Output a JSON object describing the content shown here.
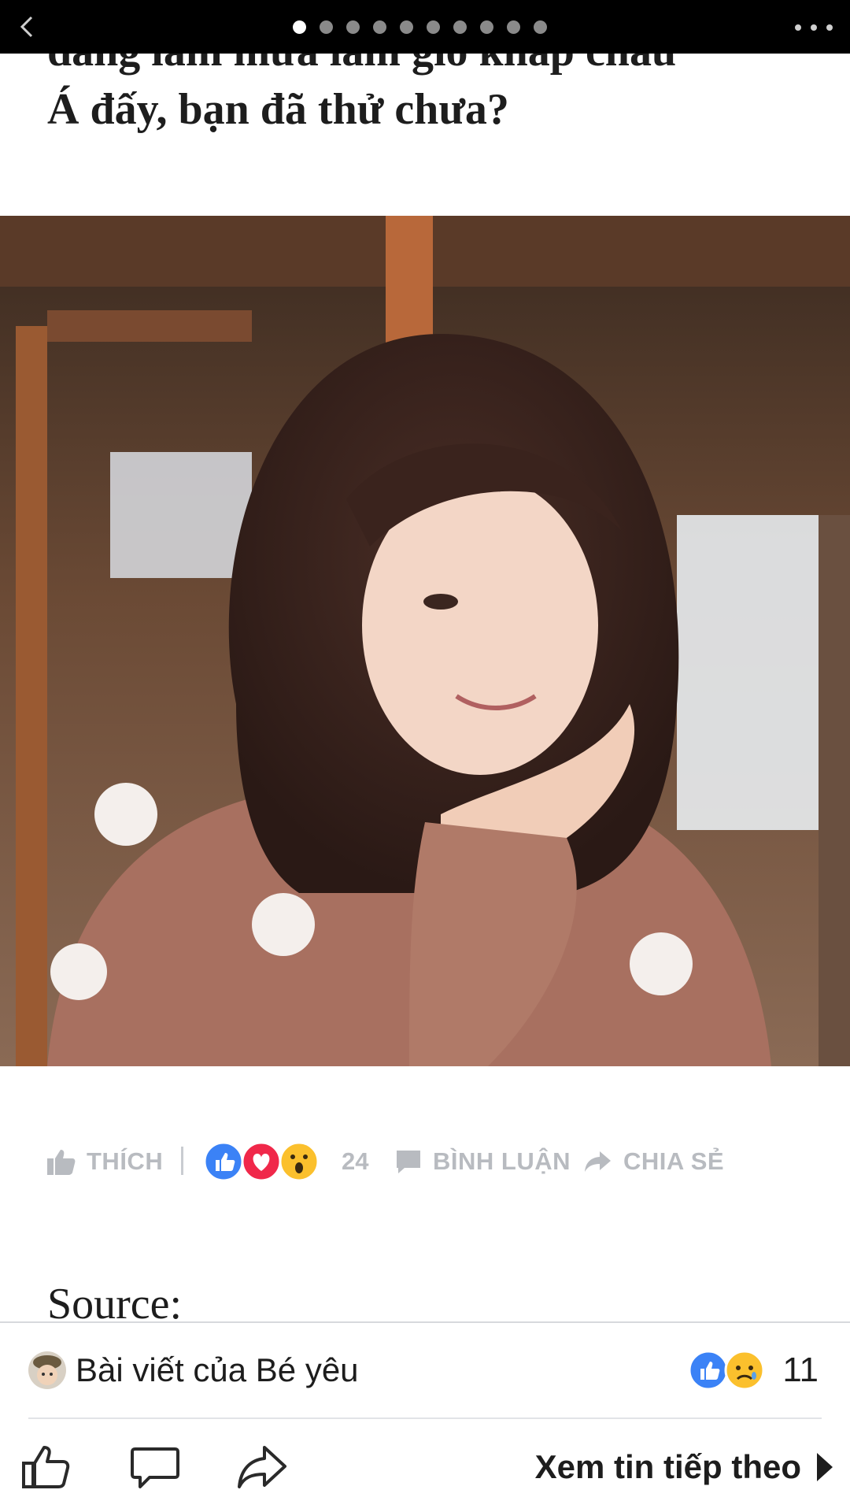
{
  "topbar": {
    "back_icon": "chevron-left-icon",
    "page_count": 10,
    "active_page": 1,
    "more_icon": "more-horizontal-icon"
  },
  "article": {
    "headline_line1": "đang làm mưa làm gió khắp châu",
    "headline_line2": "Á đấy, bạn đã thử chưa?",
    "photo_desc": "portrait-photo",
    "source_label": "Source:"
  },
  "actions": {
    "like_label": "THÍCH",
    "reaction_count": "24",
    "comment_label": "BÌNH LUẬN",
    "share_label": "CHIA SẺ"
  },
  "footer": {
    "author_text": "Bài viết của Bé yêu",
    "reaction_count": "11",
    "next_label": "Xem tin tiếp theo"
  },
  "colors": {
    "like_blue": "#3b82f6",
    "love_red": "#f0284a",
    "wow_yellow": "#fbc02d",
    "muted_gray": "#b8bbc0"
  }
}
